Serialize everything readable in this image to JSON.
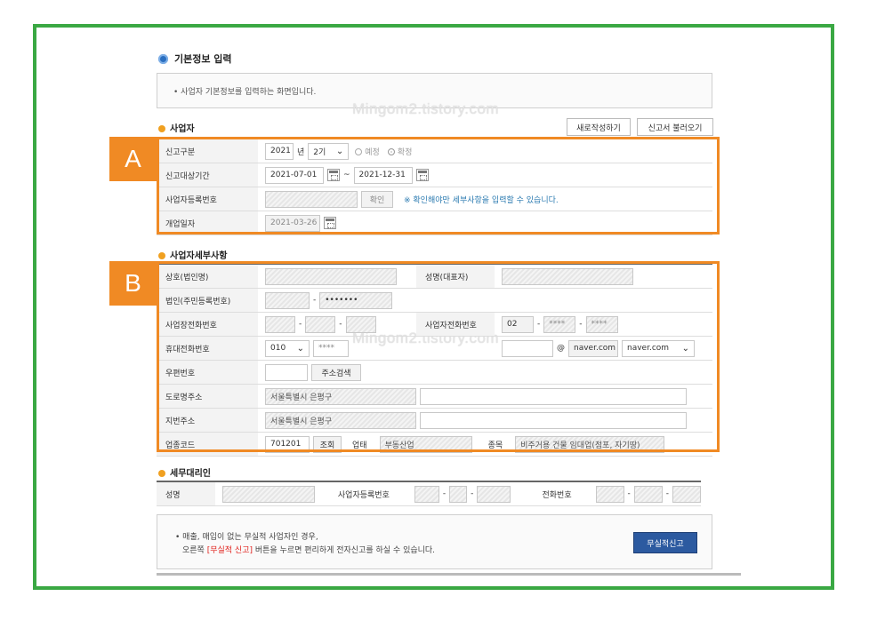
{
  "page": {
    "title": "기본정보 입력",
    "info": "• 사업자 기본정보를 입력하는 화면입니다.",
    "watermark": "Mingom2.tistory.com"
  },
  "business": {
    "section": "사업자",
    "new_btn": "새로작성하기",
    "load_btn": "신고서 불러오기",
    "report_type_label": "신고구분",
    "year": "2021",
    "year_unit": "년",
    "period": "2기",
    "radio_planned": "예정",
    "radio_confirmed": "확정",
    "period_label": "신고대상기간",
    "date_from": "2021-07-01",
    "tilde": "~",
    "date_to": "2021-12-31",
    "regno_label": "사업자등록번호",
    "confirm_btn": "확인",
    "regno_note": "※ 확인해야만 세부사항을 입력할 수 있습니다.",
    "open_label": "개업일자",
    "open_date": "2021-03-26"
  },
  "detail": {
    "section": "사업자세부사항",
    "company_label": "상호(법인명)",
    "ceo_label": "성명(대표자)",
    "corp_label": "법인(주민등록번호)",
    "corp_dash": "-",
    "corp_mask": "•••••••",
    "biz_phone_label": "사업장전화번호",
    "dash": "-",
    "biz_phone2_label": "사업자전화번호",
    "phone_area": "02",
    "phone_mask1": "****",
    "phone_mask2": "****",
    "mobile_label": "휴대전화번호",
    "mobile_prefix": "010",
    "mobile_mask": "****",
    "at": "@",
    "email_domain": "naver.com",
    "email_select": "naver.com",
    "zip_label": "우편번호",
    "zip_btn": "주소검색",
    "road_label": "도로명주소",
    "road_addr": "서울특별시 은평구",
    "jibun_label": "지번주소",
    "jibun_addr": "서울특별시 은평구",
    "code_label": "업종코드",
    "code": "701201",
    "lookup_btn": "조회",
    "type_label": "업태",
    "type_value": "부동산업",
    "item_label": "종목",
    "item_value": "비주거용 건물 임대업(점포, 자기땅)"
  },
  "agent": {
    "section": "세무대리인",
    "name_label": "성명",
    "regno_label": "사업자등록번호",
    "phone_label": "전화번호",
    "dash": "-"
  },
  "notice": {
    "line1": "• 매출, 매입이 없는 무실적 사업자인 경우,",
    "line2_pre": "오른쪽 ",
    "line2_red": "[무실적 신고]",
    "line2_post": " 버튼을 누르면 편리하게 전자신고를 하실 수 있습니다.",
    "btn": "무실적신고"
  },
  "annotations": {
    "a": "A",
    "b": "B"
  },
  "colors": {
    "frame": "#3aa843",
    "highlight": "#f08a24",
    "primary_button": "#2c5aa0",
    "alert": "#e0201b"
  }
}
